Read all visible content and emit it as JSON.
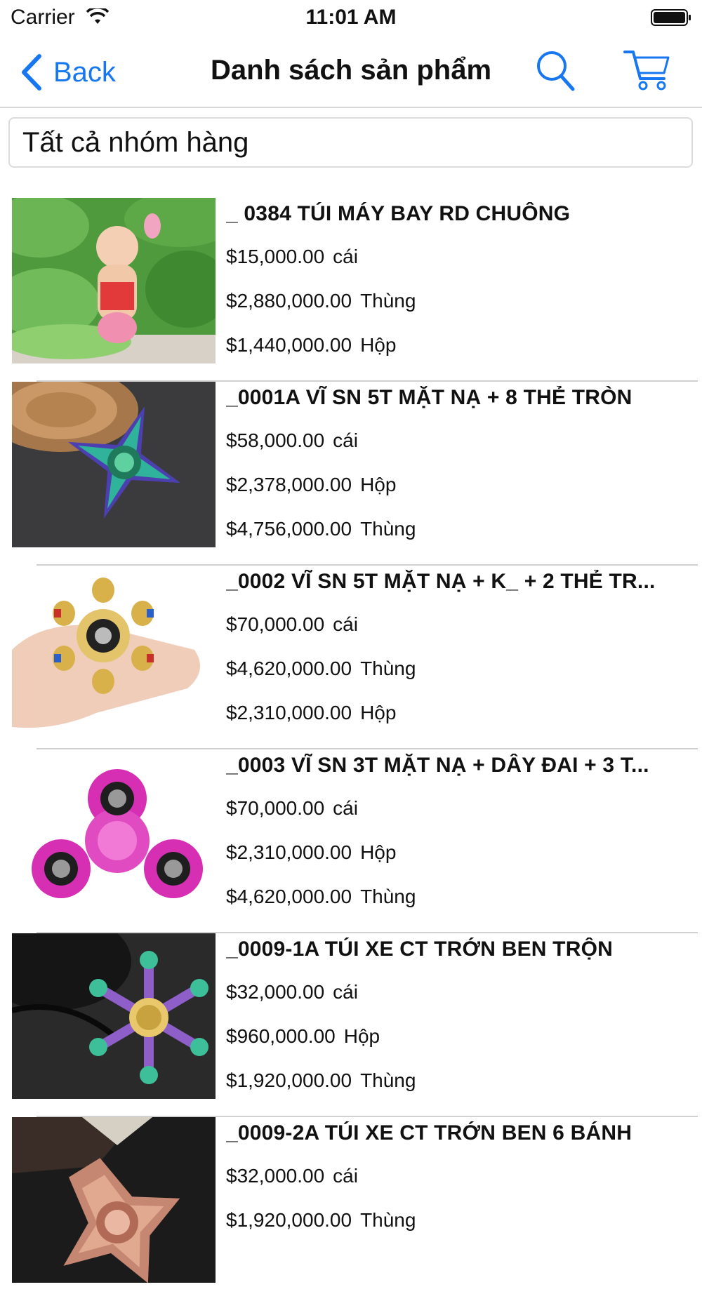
{
  "status_bar": {
    "carrier": "Carrier",
    "time": "11:01 AM"
  },
  "nav": {
    "back_label": "Back",
    "title": "Danh sách sản phẩm",
    "accent": "#1677f0"
  },
  "filter": {
    "selected": "Tất cả nhóm hàng"
  },
  "products": [
    {
      "name": "_ 0384  TÚI MÁY BAY RD CHUÔNG",
      "image": "baby-in-lotus-field-photo",
      "prices": [
        {
          "price": "$15,000.00",
          "unit": "cái"
        },
        {
          "price": "$2,880,000.00",
          "unit": "Thùng"
        },
        {
          "price": "$1,440,000.00",
          "unit": "Hộp"
        }
      ]
    },
    {
      "name": "_0001A  VĨ SN 5T MẶT NẠ + 8 THẺ TRÒN",
      "image": "rainbow-four-blade-fidget-spinner-photo",
      "prices": [
        {
          "price": "$58,000.00",
          "unit": "cái"
        },
        {
          "price": "$2,378,000.00",
          "unit": "Hộp"
        },
        {
          "price": "$4,756,000.00",
          "unit": "Thùng"
        }
      ]
    },
    {
      "name": "_0002  VĨ SN 5T MẶT NẠ + K_ + 2 THẺ TR...",
      "image": "gold-six-arm-fidget-spinner-in-hand-photo",
      "prices": [
        {
          "price": "$70,000.00",
          "unit": "cái"
        },
        {
          "price": "$4,620,000.00",
          "unit": "Thùng"
        },
        {
          "price": "$2,310,000.00",
          "unit": "Hộp"
        }
      ]
    },
    {
      "name": "_0003  VĨ SN 3T MẶT NẠ + DÂY ĐAI + 3 T...",
      "image": "pink-tri-fidget-spinner-photo",
      "prices": [
        {
          "price": "$70,000.00",
          "unit": "cái"
        },
        {
          "price": "$2,310,000.00",
          "unit": "Hộp"
        },
        {
          "price": "$4,620,000.00",
          "unit": "Thùng"
        }
      ]
    },
    {
      "name": "_0009-1A  TÚI XE CT TRỚN BEN TRỘN",
      "image": "rainbow-six-arm-fidget-spinner-photo",
      "prices": [
        {
          "price": "$32,000.00",
          "unit": "cái"
        },
        {
          "price": "$960,000.00",
          "unit": "Hộp"
        },
        {
          "price": "$1,920,000.00",
          "unit": "Thùng"
        }
      ]
    },
    {
      "name": "_0009-2A  TÚI XE CT TRỚN BEN 6 BÁNH",
      "image": "rose-gold-fidget-spinner-photo",
      "prices": [
        {
          "price": "$32,000.00",
          "unit": "cái"
        },
        {
          "price": "$1,920,000.00",
          "unit": "Thùng"
        },
        {
          "price": "",
          "unit": ""
        }
      ]
    }
  ]
}
